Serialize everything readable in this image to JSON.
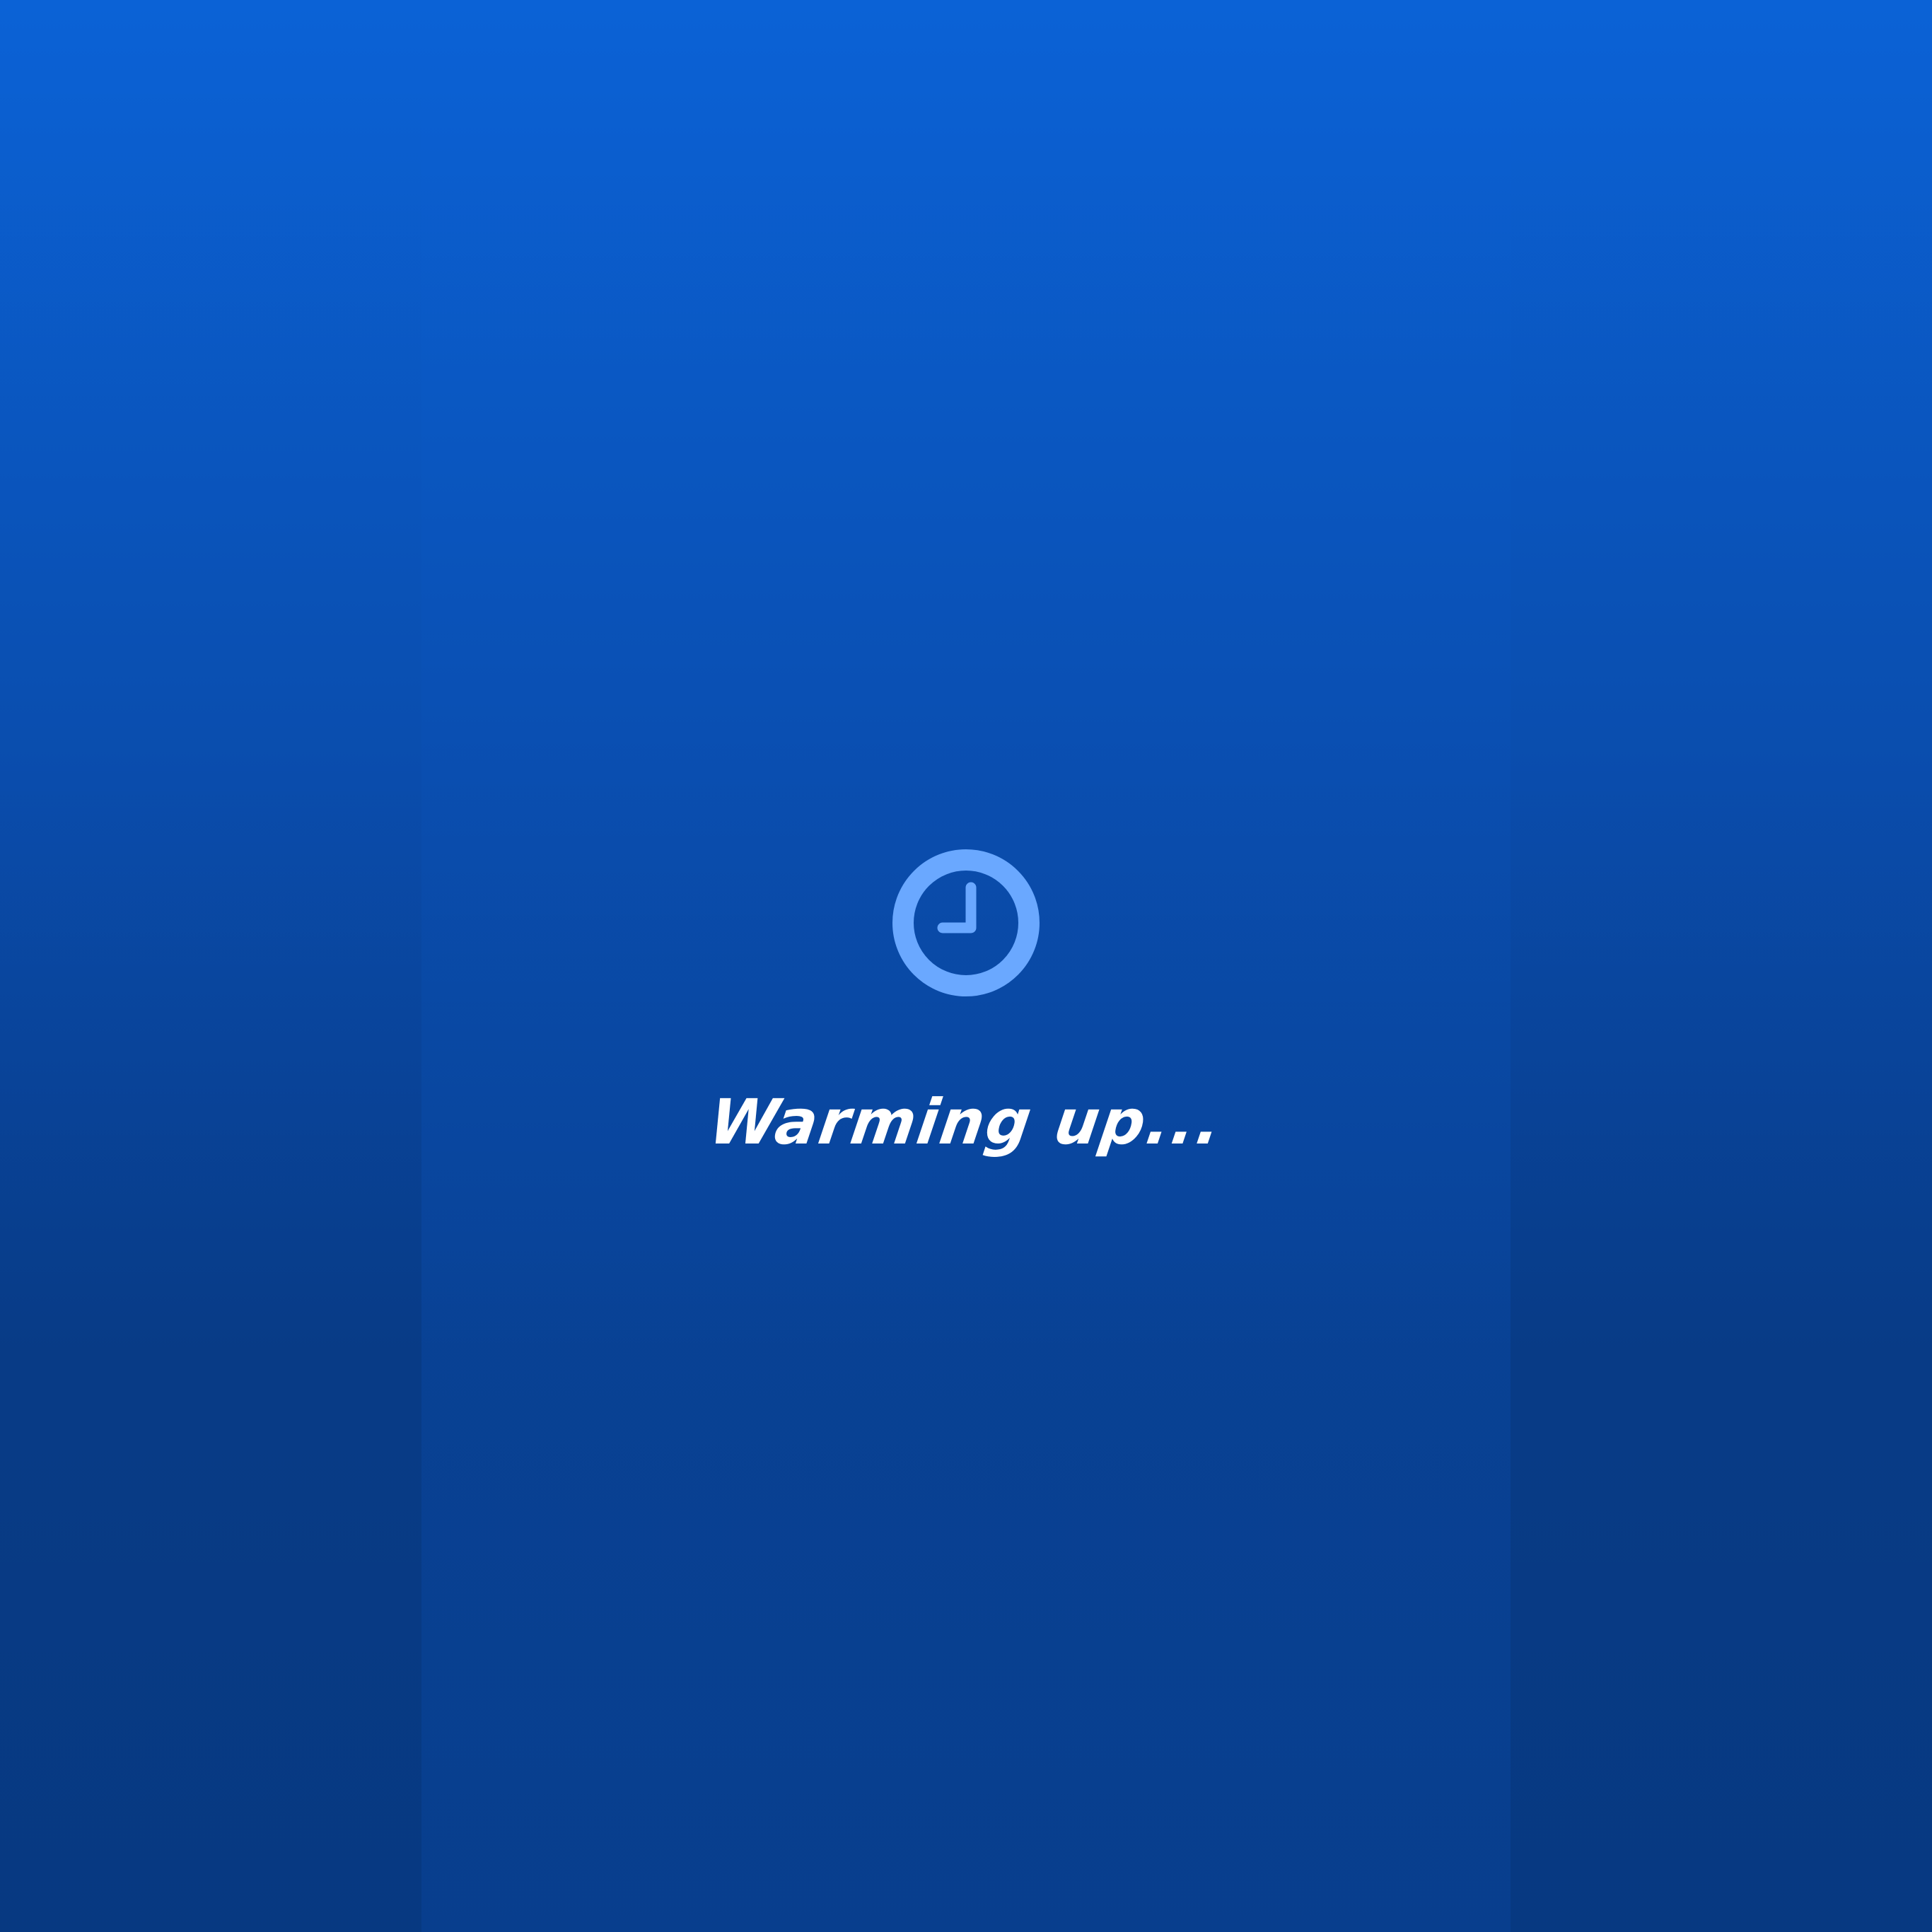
{
  "loading_screen": {
    "status_text": "Warming up...",
    "icon": "clock-icon",
    "colors": {
      "background_top": "#0b62d6",
      "background_bottom": "#073c88",
      "icon": "#6aa8ff",
      "text": "#ffffff"
    }
  }
}
